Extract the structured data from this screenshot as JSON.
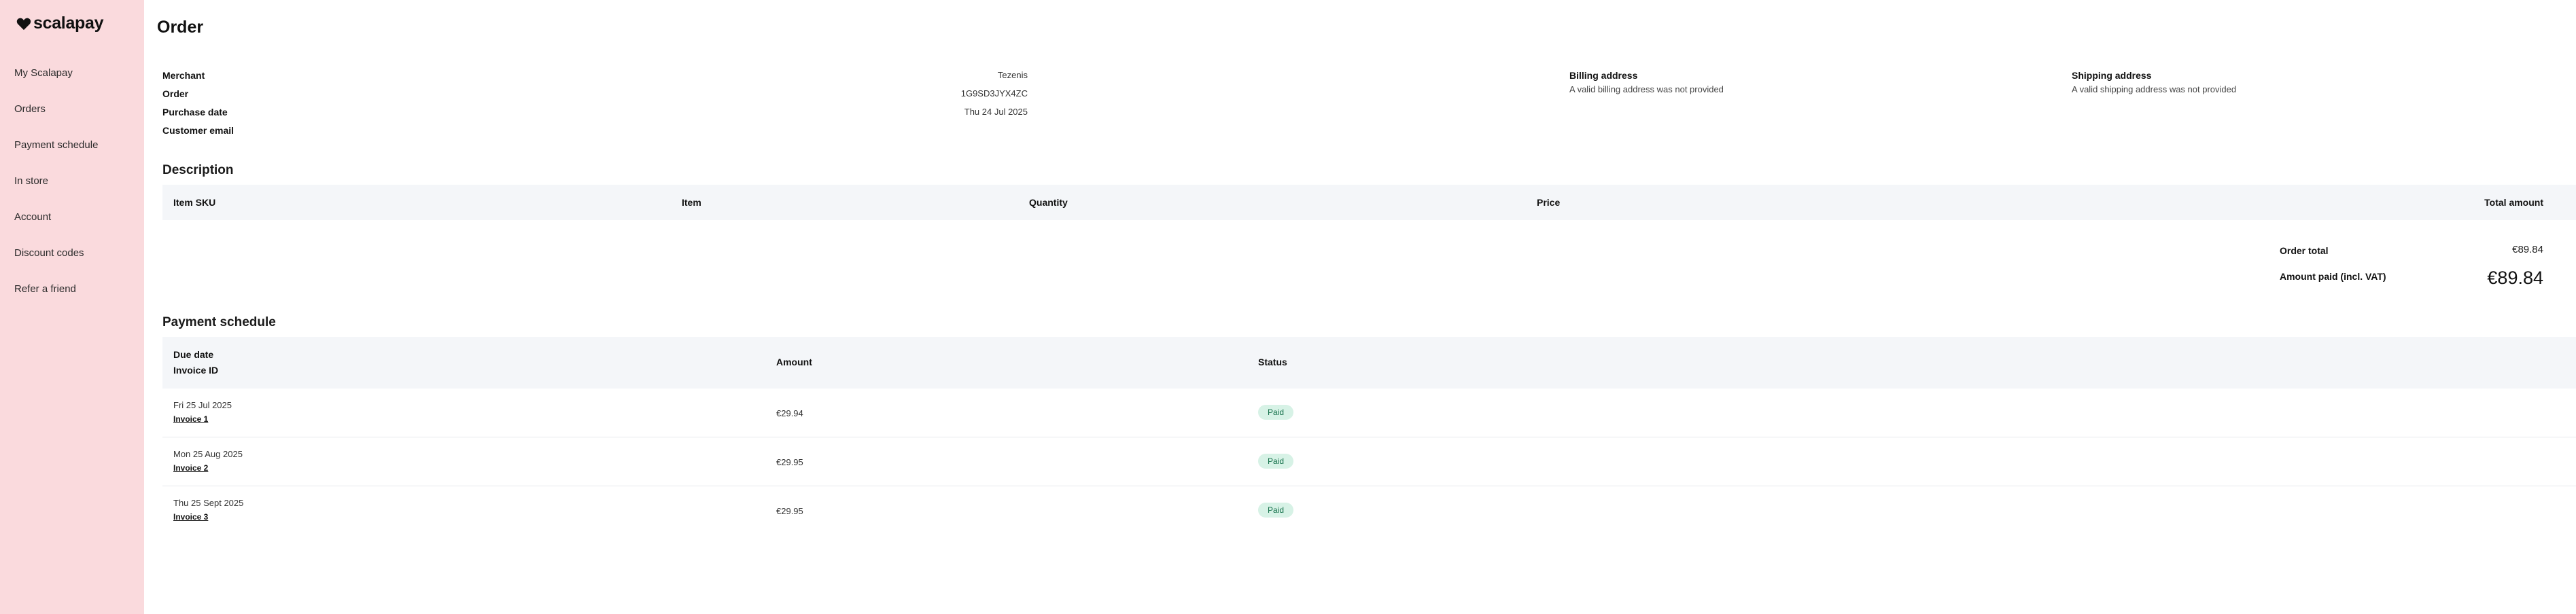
{
  "brand": {
    "name": "scalapay"
  },
  "sidebar": {
    "items": [
      {
        "label": "My Scalapay"
      },
      {
        "label": "Orders"
      },
      {
        "label": "Payment schedule"
      },
      {
        "label": "In store"
      },
      {
        "label": "Account"
      },
      {
        "label": "Discount codes"
      },
      {
        "label": "Refer a friend"
      }
    ]
  },
  "page": {
    "title": "Order"
  },
  "details": {
    "merchant_label": "Merchant",
    "merchant_value": "Tezenis",
    "order_label": "Order",
    "order_value": "1G9SD3JYX4ZC",
    "purchase_date_label": "Purchase date",
    "purchase_date_value": "Thu 24 Jul 2025",
    "customer_email_label": "Customer email",
    "customer_email_value": ""
  },
  "billing": {
    "title": "Billing address",
    "text": "A valid billing address was not provided"
  },
  "shipping": {
    "title": "Shipping address",
    "text": "A valid shipping address was not provided"
  },
  "description": {
    "title": "Description",
    "columns": {
      "sku": "Item SKU",
      "item": "Item",
      "quantity": "Quantity",
      "price": "Price",
      "total": "Total amount"
    }
  },
  "totals": {
    "order_total_label": "Order total",
    "order_total_value": "€89.84",
    "amount_paid_label": "Amount paid (incl. VAT)",
    "amount_paid_value": "€89.84"
  },
  "payment_schedule": {
    "title": "Payment schedule",
    "columns": {
      "due_date": "Due date",
      "invoice_id": "Invoice ID",
      "amount": "Amount",
      "status": "Status"
    },
    "rows": [
      {
        "date": "Fri 25 Jul 2025",
        "invoice": "Invoice 1",
        "amount": "€29.94",
        "status": "Paid"
      },
      {
        "date": "Mon 25 Aug 2025",
        "invoice": "Invoice 2",
        "amount": "€29.95",
        "status": "Paid"
      },
      {
        "date": "Thu 25 Sept 2025",
        "invoice": "Invoice 3",
        "amount": "€29.95",
        "status": "Paid"
      }
    ]
  },
  "colors": {
    "sidebar_bg": "#fadadd",
    "table_header_bg": "#f4f6f9",
    "paid_badge_bg": "#d7f2e6",
    "paid_badge_text": "#14704a"
  }
}
